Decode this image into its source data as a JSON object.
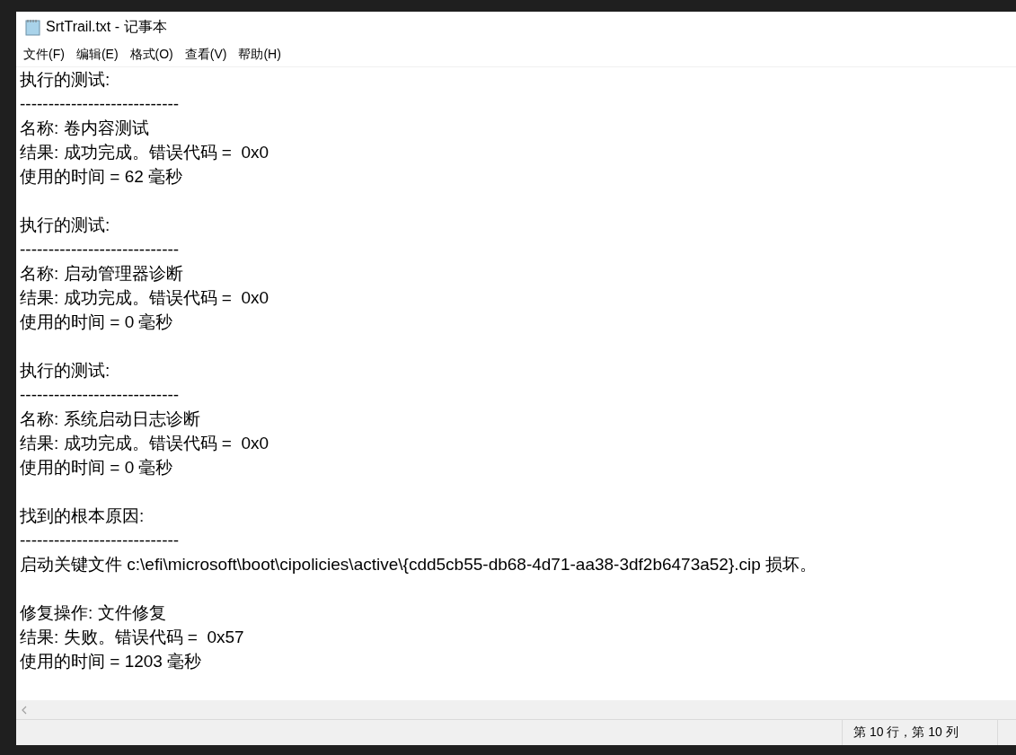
{
  "window": {
    "title": "SrtTrail.txt - 记事本"
  },
  "menu": [
    "文件(F)",
    "编辑(E)",
    "格式(O)",
    "查看(V)",
    "帮助(H)"
  ],
  "blocks": [
    {
      "lines": [
        "执行的测试:",
        "----------------------------",
        "名称: 卷内容测试",
        "结果: 成功完成。错误代码 =  0x0",
        "使用的时间 = 62 毫秒"
      ]
    },
    {
      "lines": [
        "执行的测试:",
        "----------------------------",
        "名称: 启动管理器诊断",
        "结果: 成功完成。错误代码 =  0x0",
        "使用的时间 = 0 毫秒"
      ]
    },
    {
      "lines": [
        "执行的测试:",
        "----------------------------",
        "名称: 系统启动日志诊断",
        "结果: 成功完成。错误代码 =  0x0",
        "使用的时间 = 0 毫秒"
      ]
    },
    {
      "lines": [
        "找到的根本原因:",
        "----------------------------",
        "启动关键文件 c:\\efi\\microsoft\\boot\\cipolicies\\active\\{cdd5cb55-db68-4d71-aa38-3df2b6473a52}.cip 损坏。"
      ]
    },
    {
      "lines": [
        "修复操作: 文件修复",
        "结果: 失败。错误代码 =  0x57",
        "使用的时间 = 1203 毫秒"
      ]
    }
  ],
  "status_bar": {
    "position": "第 10 行，第 10 列"
  }
}
